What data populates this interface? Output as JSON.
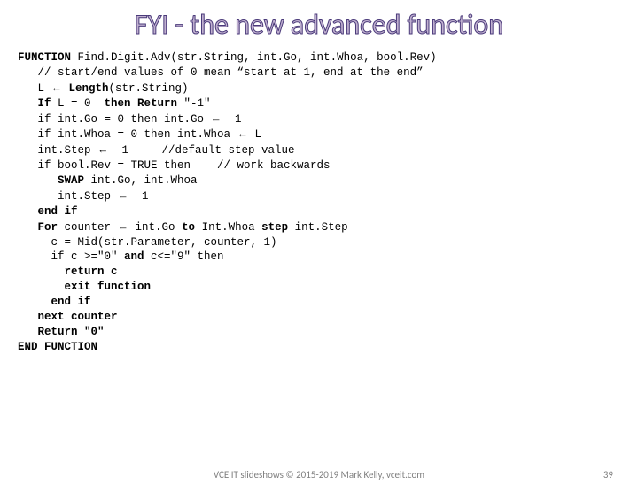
{
  "title": "FYI - the new advanced function",
  "code": {
    "l1a": "FUNCTION",
    "l1b": " Find.Digit.Adv(str.String, int.Go, int.Whoa, bool.Rev)",
    "l2": "   // start/end values of 0 mean “start at 1, end at the end”",
    "l3a": "   L ",
    "l3arrow": "←",
    "l3b": " Length",
    "l3c": "(str.String)",
    "l4a": "   If",
    "l4b": " L = 0  ",
    "l4c": "then Return ",
    "l4d": "\"-1\"",
    "l5a": "   if int.Go = 0 then int.Go ",
    "l5arrow": "←",
    "l5b": "  1",
    "l6a": "   if int.Whoa = 0 then int.Whoa ",
    "l6arrow": "←",
    "l6b": " L",
    "l7a": "   int.Step ",
    "l7arrow": "←",
    "l7b": "  1     //default step value",
    "l8": "   if bool.Rev = TRUE then    // work backwards",
    "l9a": "      SWAP",
    "l9b": " int.Go, int.Whoa",
    "l10a": "      int.Step ",
    "l10arrow": "←",
    "l10b": " -1",
    "l11": "   end if",
    "l12a": "   For",
    "l12b": " counter ",
    "l12arrow": "←",
    "l12c": " int.Go ",
    "l12d": "to",
    "l12e": " Int.Whoa ",
    "l12f": "step",
    "l12g": " int.Step",
    "l13": "     c = Mid(str.Parameter, counter, 1)",
    "l14a": "     if c >=\"0\" ",
    "l14b": "and",
    "l14c": " c<=\"9\" then",
    "l15": "       return c",
    "l16": "       exit function",
    "l17": "     end if",
    "l18": "   next counter",
    "l19": "   Return \"0\"",
    "l20": "END FUNCTION"
  },
  "footer": {
    "center": "VCE IT slideshows © 2015-2019 Mark Kelly, vceit.com",
    "pageNum": "39"
  }
}
